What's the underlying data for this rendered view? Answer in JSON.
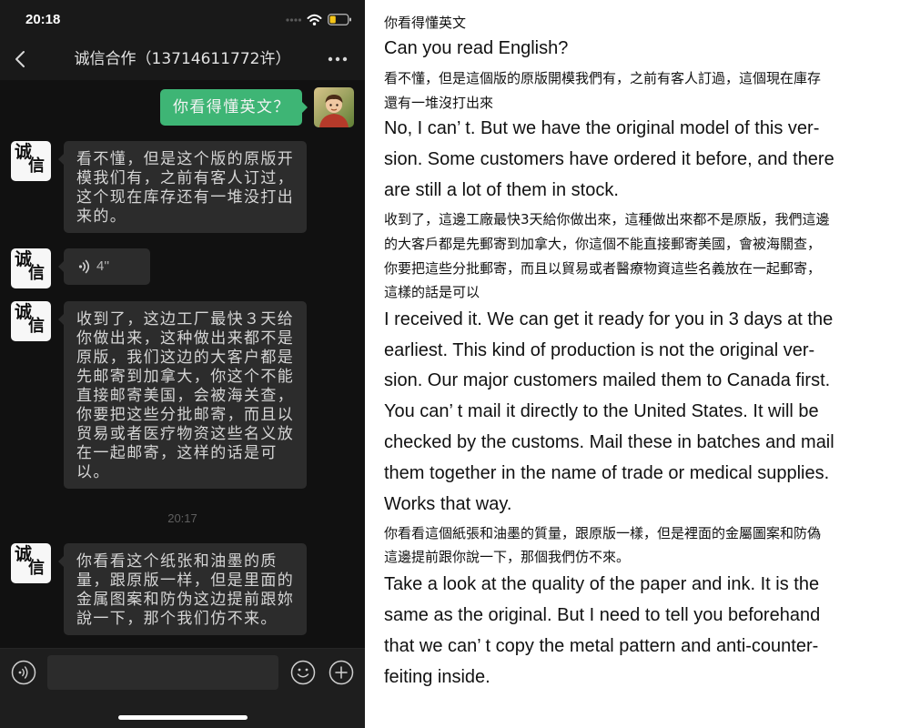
{
  "status_bar": {
    "time": "20:18",
    "icons": [
      "signal-icon",
      "wifi-icon",
      "battery-icon"
    ],
    "battery_level": 0.35
  },
  "header": {
    "back_icon": "chevron-left-icon",
    "title": "诚信合作（13714611772许）",
    "more_icon": "more-dots-icon"
  },
  "chat": {
    "contact_avatar_logo": [
      "诚",
      "信"
    ],
    "messages": [
      {
        "outgoing": true,
        "lines": [
          "你看得懂英文？"
        ]
      },
      {
        "outgoing": false,
        "lines": [
          "看不懂，但是这个版的原版开",
          "模我们有，之前有客人订过，",
          "这个现在库存还有一堆没打出",
          "来的。"
        ]
      },
      {
        "outgoing": false,
        "voice_duration": "4''",
        "icon": "voice-wave-icon"
      },
      {
        "outgoing": false,
        "lines": [
          "收到了，这边工厂最快３天给",
          "你做出来，这种做出来都不是",
          "原版，我们这边的大客户都是",
          "先邮寄到加拿大，你这个不能",
          "直接邮寄美国，会被海关查，",
          "你要把这些分批邮寄，而且以",
          "贸易或者医疗物资这些名义放",
          "在一起邮寄，这样的话是可",
          "以。"
        ]
      },
      {
        "timestamp": "20:17"
      },
      {
        "outgoing": false,
        "lines": [
          "你看看这个纸张和油墨的质",
          "量，跟原版一样，但是里面的",
          "金属图案和防伪这边提前跟妳",
          "說一下，那个我们仿不来。"
        ]
      }
    ]
  },
  "input_bar": {
    "voice_icon": "voice-mode-icon",
    "value": "",
    "emoji_icon": "emoji-icon",
    "plus_icon": "plus-icon"
  },
  "translation": {
    "pairs": [
      {
        "chinese": [
          "你看得懂英文"
        ],
        "english": [
          "Can you read English?"
        ]
      },
      {
        "chinese": [
          "看不懂，但是這個版的原版開模我們有，之前有客人訂過，這個現在庫存",
          "還有一堆沒打出來"
        ],
        "english": [
          "No, I can’ t. But we have the original model of this ver-",
          "sion. Some customers have ordered it before, and there",
          "are still a lot of them in stock."
        ]
      },
      {
        "chinese": [
          "收到了，這邊工廠最快3天給你做出來，這種做出來都不是原版，我們這邊",
          "的大客戶都是先郵寄到加拿大，你這個不能直接郵寄美國，會被海關查，",
          "你要把這些分批郵寄，而且以貿易或者醫療物資這些名義放在一起郵寄，",
          "這樣的話是可以"
        ],
        "english": [
          "I received it. We can get it ready for you in 3 days at the",
          "earliest. This kind of production is not the original ver-",
          "sion. Our major customers mailed them to Canada first.",
          "You can’ t mail it directly to the United States. It will be",
          "checked by the customs. Mail these in batches and mail",
          "them together in the name of trade or medical supplies.",
          "Works that way."
        ]
      },
      {
        "chinese": [
          "你看看這個紙張和油墨的質量，跟原版一樣，但是裡面的金屬圖案和防偽",
          "這邊提前跟你說一下，那個我們仿不來。"
        ],
        "english": [
          "Take a look at the quality of the paper and ink. It is the",
          "same as the original. But I need to tell you beforehand",
          "that we can’ t copy the metal pattern and anti-counter-",
          "feiting inside."
        ]
      }
    ]
  },
  "colors": {
    "chat_background": "#111111",
    "header_background": "#191919",
    "input_bar_background": "#1e1e1e",
    "received_bubble": "#2c2c2c",
    "sent_bubble": "#3eb575",
    "bubble_text": "#d5d5d5",
    "timestamp_text": "#5f5f5f",
    "battery_fill": "#f5c518",
    "translation_background": "#ffffff",
    "translation_text": "#111111"
  }
}
